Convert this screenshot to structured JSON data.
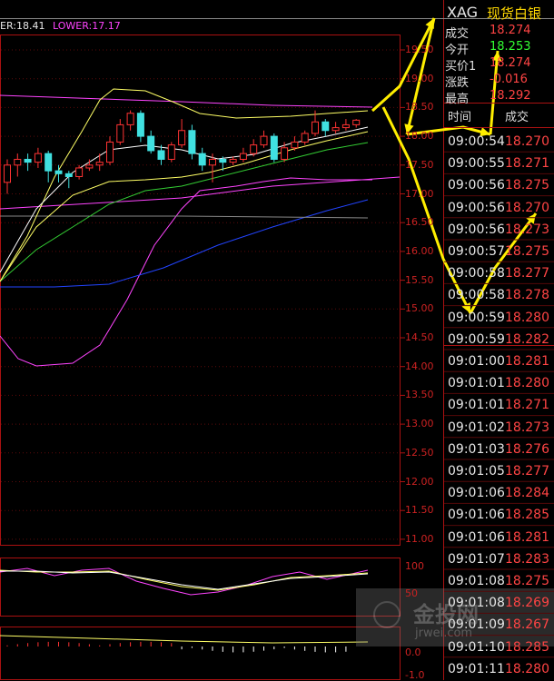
{
  "indicator_bar": {
    "upper": "ER:18.41",
    "lower": "LOWER:17.17"
  },
  "symbol": {
    "code": "XAG",
    "name": "现货白银"
  },
  "quote": [
    {
      "label": "成交",
      "value": "18.274"
    },
    {
      "label": "今开",
      "value": "18.253"
    },
    {
      "label": "买价1",
      "value": "18.274"
    },
    {
      "label": "涨跌",
      "value": "-0.016"
    },
    {
      "label": "最高",
      "value": "18.292"
    }
  ],
  "trades_header": {
    "time": "时间",
    "price": "成交"
  },
  "trades": [
    {
      "time": "09:00:54",
      "price": "18.270"
    },
    {
      "time": "09:00:55",
      "price": "18.271"
    },
    {
      "time": "09:00:56",
      "price": "18.275"
    },
    {
      "time": "09:00:56",
      "price": "18.270"
    },
    {
      "time": "09:00:56",
      "price": "18.273"
    },
    {
      "time": "09:00:57",
      "price": "18.275"
    },
    {
      "time": "09:00:58",
      "price": "18.277"
    },
    {
      "time": "09:00:58",
      "price": "18.278"
    },
    {
      "time": "09:00:59",
      "price": "18.280"
    },
    {
      "time": "09:00:59",
      "price": "18.282"
    },
    {
      "time": "09:01:00",
      "price": "18.281"
    },
    {
      "time": "09:01:01",
      "price": "18.280"
    },
    {
      "time": "09:01:01",
      "price": "18.271"
    },
    {
      "time": "09:01:02",
      "price": "18.273"
    },
    {
      "time": "09:01:03",
      "price": "18.276"
    },
    {
      "time": "09:01:05",
      "price": "18.277"
    },
    {
      "time": "09:01:06",
      "price": "18.284"
    },
    {
      "time": "09:01:06",
      "price": "18.285"
    },
    {
      "time": "09:01:06",
      "price": "18.281"
    },
    {
      "time": "09:01:07",
      "price": "18.283"
    },
    {
      "time": "09:01:08",
      "price": "18.275"
    },
    {
      "time": "09:01:08",
      "price": "18.269"
    },
    {
      "time": "09:01:09",
      "price": "18.267"
    },
    {
      "time": "09:01:10",
      "price": "18.285"
    },
    {
      "time": "09:01:11",
      "price": "18.280"
    }
  ],
  "price_axis": [
    "19.50",
    "19.00",
    "18.50",
    "18.00",
    "17.50",
    "17.00",
    "16.50",
    "16.00",
    "15.50",
    "15.00",
    "14.50",
    "14.00",
    "13.50",
    "13.00",
    "12.50",
    "12.00",
    "11.50",
    "11.00"
  ],
  "osc_axis": [
    "100",
    "50"
  ],
  "macd_axis": [
    "0.0",
    "-1.0"
  ],
  "watermark": {
    "brand": "金投网",
    "url": "jrwei.com"
  },
  "colors": {
    "up": "#ff3333",
    "down": "#40e0e0",
    "ma_white": "#ffffff",
    "ma_yellow": "#ffff66",
    "ma_green": "#33cc33",
    "ma_magenta": "#ff44ff",
    "ma_blue": "#2244ff",
    "arrow": "#ffee00",
    "grid": "#aa1111"
  }
}
